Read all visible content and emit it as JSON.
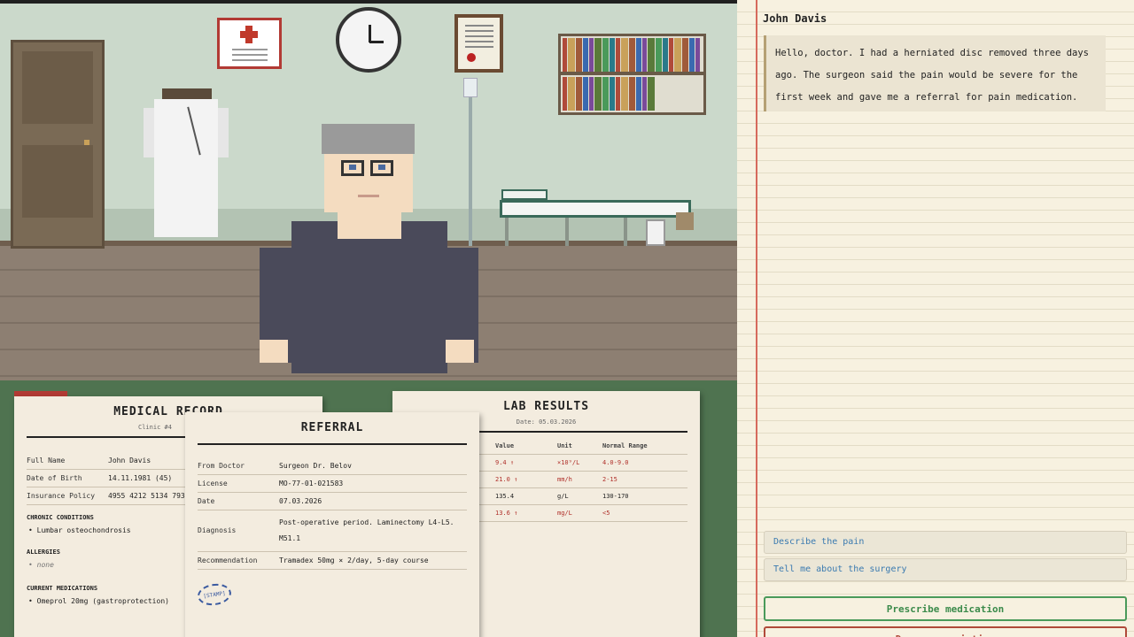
{
  "patient": {
    "name": "John Davis"
  },
  "dialogue": {
    "message": "Hello, doctor. I had a herniated disc removed three days ago. The surgeon said the pain would be severe for the first week and gave me a referral for pain medication."
  },
  "choices": [
    {
      "label": "Describe the pain"
    },
    {
      "label": "Tell me about the surgery"
    }
  ],
  "actions": {
    "prescribe": "Prescribe medication",
    "deny": "Deny prescription"
  },
  "medical_record": {
    "title": "MEDICAL RECORD",
    "clinic": "Clinic #4",
    "fields": [
      {
        "label": "Full Name",
        "value": "John Davis"
      },
      {
        "label": "Date of Birth",
        "value": "14.11.1981 (45)"
      },
      {
        "label": "Insurance Policy",
        "value": "4955 4212 5134 7930"
      }
    ],
    "chronic_title": "CHRONIC CONDITIONS",
    "chronic": "Lumbar osteochondrosis",
    "allergies_title": "ALLERGIES",
    "allergies": "none",
    "meds_title": "CURRENT MEDICATIONS",
    "meds": "Omeprol 20mg (gastroprotection)"
  },
  "referral": {
    "title": "REFERRAL",
    "fields": [
      {
        "label": "From Doctor",
        "value": "Surgeon Dr. Belov"
      },
      {
        "label": "License",
        "value": "MO-77-01-021583"
      },
      {
        "label": "Date",
        "value": "07.03.2026"
      },
      {
        "label": "Diagnosis",
        "value": "Post-operative period. Laminectomy L4-L5. M51.1"
      },
      {
        "label": "Recommendation",
        "value": "Tramadex 50mg × 2/day, 5-day course"
      }
    ],
    "stamp": "[STAMP]"
  },
  "lab_results": {
    "title": "LAB RESULTS",
    "date": "Date: 05.03.2026",
    "headers": {
      "value": "Value",
      "unit": "Unit",
      "range": "Normal Range"
    },
    "rows": [
      {
        "value": "9.4 ↑",
        "unit": "×10⁹/L",
        "range": "4.0-9.0",
        "flag": true
      },
      {
        "value": "21.0 ↑",
        "unit": "mm/h",
        "range": "2-15",
        "flag": true
      },
      {
        "value": "135.4",
        "unit": "g/L",
        "range": "130-170",
        "flag": false
      },
      {
        "value": "13.6 ↑",
        "unit": "mg/L",
        "range": "<5",
        "flag": true
      }
    ]
  },
  "colors": {
    "accent_green": "#4a9a5a",
    "accent_red": "#b04a3a",
    "desk": "#4f7350"
  }
}
